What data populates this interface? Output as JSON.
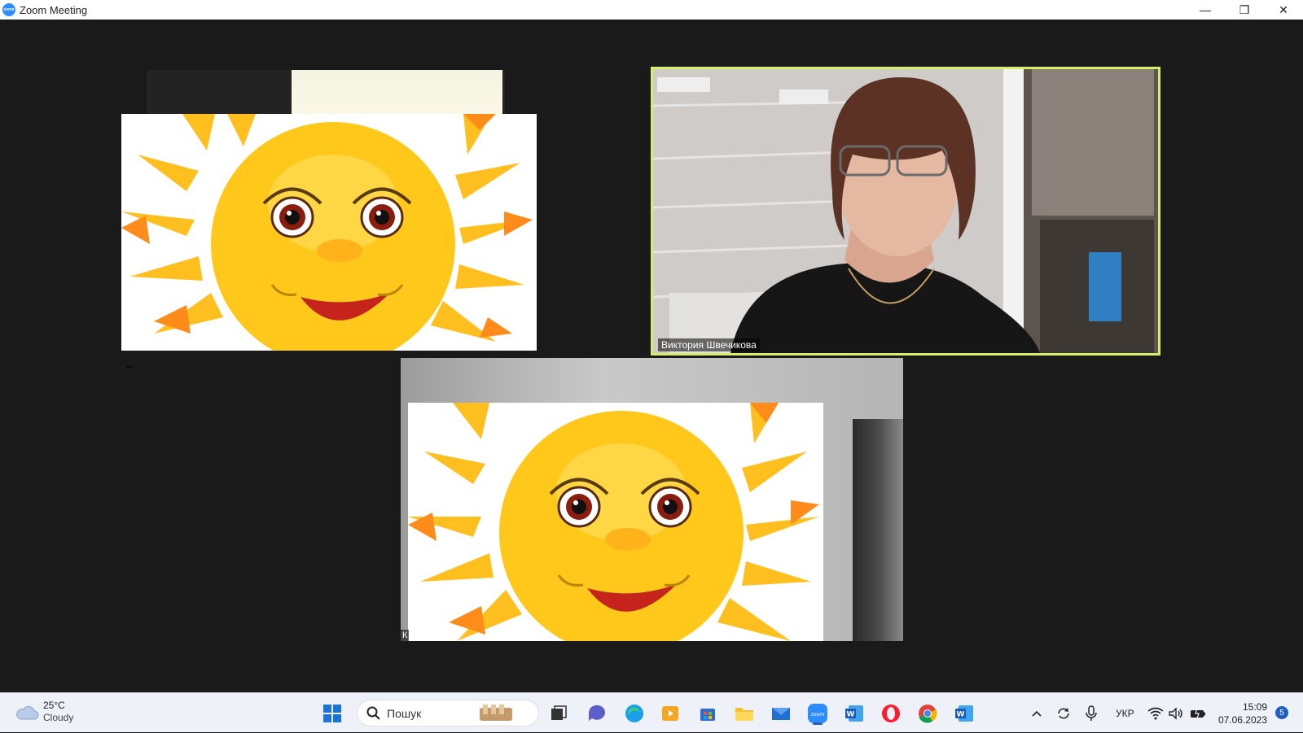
{
  "window": {
    "title": "Zoom Meeting",
    "minimize": "—",
    "restore": "❐",
    "close": "✕"
  },
  "participants": [
    {
      "name": ""
    },
    {
      "name": "Виктория Швечикова"
    },
    {
      "name": "К"
    }
  ],
  "taskbar": {
    "weather": {
      "temp": "25°C",
      "condition": "Cloudy"
    },
    "search": {
      "placeholder": "Пошук"
    },
    "tray": {
      "language": "УКР"
    },
    "clock": {
      "time": "15:09",
      "date": "07.06.2023"
    },
    "notifications": "5"
  },
  "colors": {
    "active_speaker_border": "#d7ee6a",
    "zoom_blue": "#2d8cff",
    "sun_yellow": "#ffd21a"
  }
}
